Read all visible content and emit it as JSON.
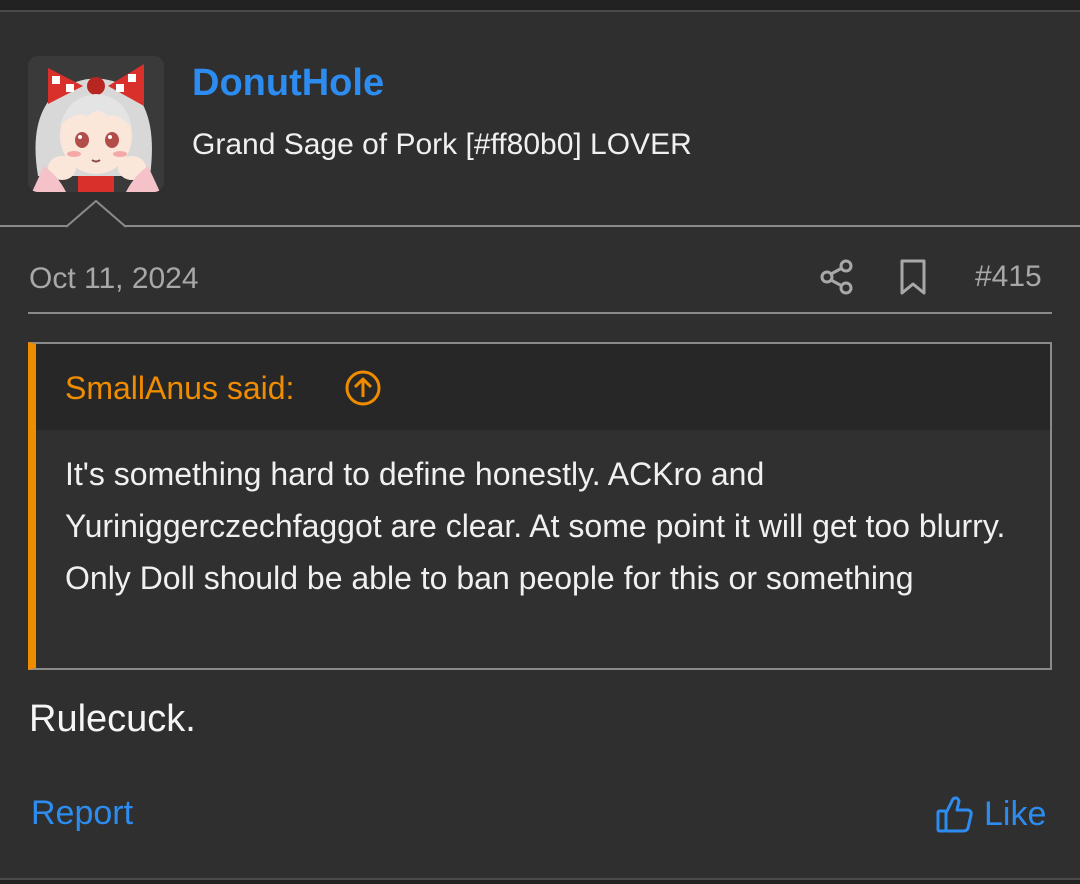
{
  "user": {
    "username": "DonutHole",
    "title": "Grand Sage of Pork [#ff80b0] LOVER",
    "avatar_icon": "anime-avatar-icon"
  },
  "post": {
    "date": "Oct 11, 2024",
    "number": "#415",
    "share_icon": "share-icon",
    "bookmark_icon": "bookmark-icon"
  },
  "quote": {
    "author_label": "SmallAnus said:",
    "jump_icon": "arrow-up-circle-icon",
    "text": "It's something hard to define honestly. ACKro and Yuriniggerczechfaggot are clear. At some point it will get too blurry. Only Doll should be able to ban people for this or something"
  },
  "reply": {
    "text": "Rulecuck."
  },
  "actions": {
    "report_label": "Report",
    "like_label": "Like",
    "like_icon": "thumbs-up-icon"
  },
  "colors": {
    "accent": "#2d8cf0",
    "quote_accent": "#f08c00",
    "background": "#2f2f2f"
  }
}
